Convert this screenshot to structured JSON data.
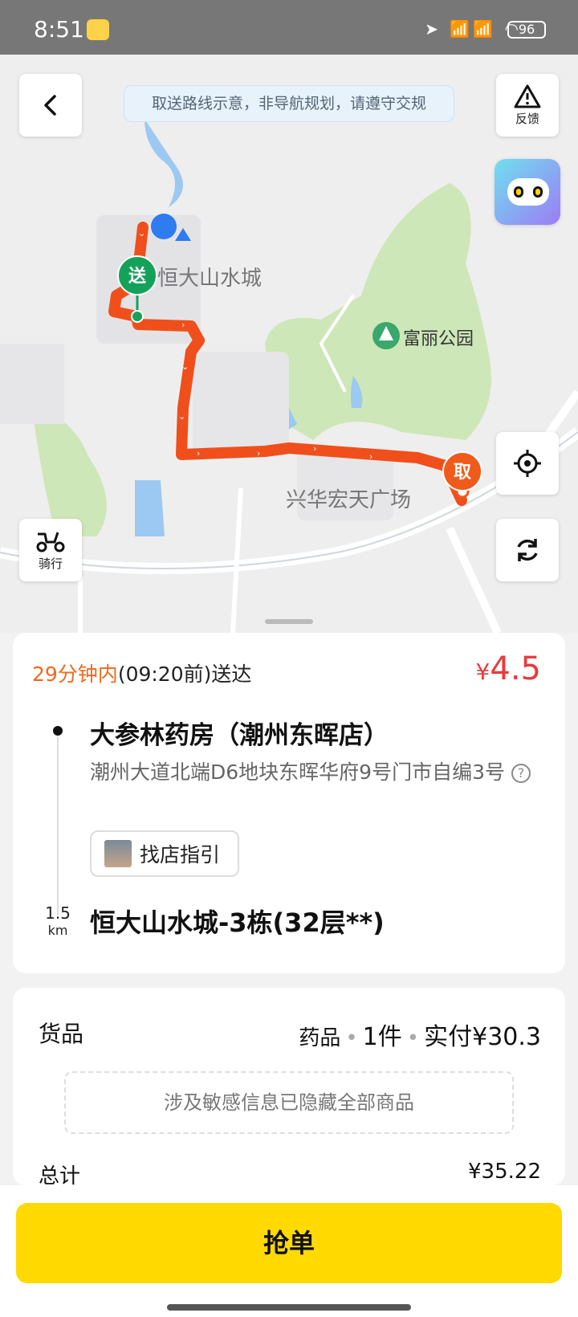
{
  "status_bar": {
    "time": "8:51",
    "signal": "HD HD",
    "battery": "96"
  },
  "map": {
    "notice": "取送路线示意，非导航规划，请遵守交规",
    "feedback_label": "反馈",
    "ride_label": "骑行",
    "places": {
      "destination": "恒大山水城",
      "park": "富丽公园",
      "plaza": "兴华宏天广场"
    },
    "markers": {
      "deliver": "送",
      "pickup": "取"
    },
    "colors": {
      "route": "#f04f1b",
      "deliver": "#14a25a",
      "pickup": "#f05a1a",
      "park": "#cde7b8",
      "water": "#9cc9f1"
    }
  },
  "order": {
    "deadline_highlight": "29分钟内",
    "deadline_rest": "(09:20前)送达",
    "price_symbol": "¥",
    "price_value": "4.5",
    "store_name": "大参林药房（潮州东晖店）",
    "store_address": "潮州大道北端D6地块东晖华府9号门市自编3号",
    "guide_button": "找店指引",
    "distance_value": "1.5",
    "distance_unit": "km",
    "destination": "恒大山水城-3栋(32层**)"
  },
  "goods": {
    "label": "货品",
    "category": "药品",
    "count": "1件",
    "paid": "实付¥30.3",
    "hidden_notice": "涉及敏感信息已隐藏全部商品",
    "total_label": "总计",
    "total_value": "¥35.22"
  },
  "actions": {
    "grab_label": "抢单"
  }
}
